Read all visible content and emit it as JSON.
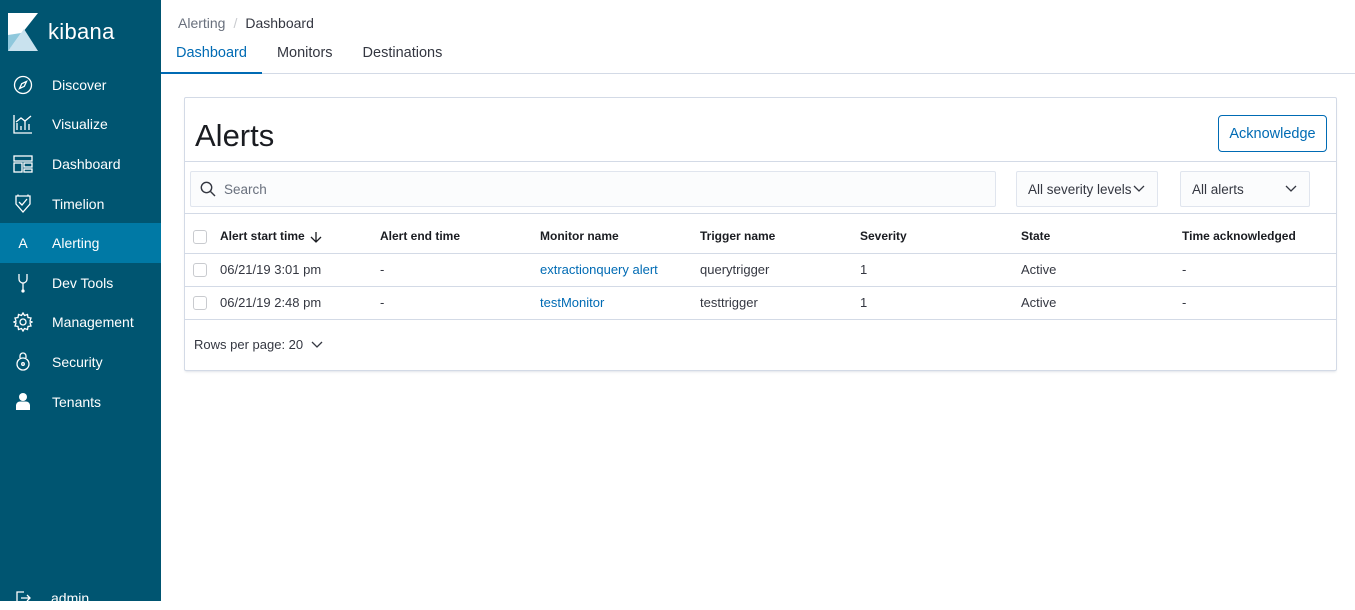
{
  "app": {
    "logo_text": "kibana"
  },
  "sidebar": {
    "items": [
      {
        "label": "Discover",
        "icon": "compass-icon"
      },
      {
        "label": "Visualize",
        "icon": "chart-icon"
      },
      {
        "label": "Dashboard",
        "icon": "dashboard-icon"
      },
      {
        "label": "Timelion",
        "icon": "timelion-icon"
      },
      {
        "label": "Alerting",
        "icon": "alerting-letter-icon",
        "active": true,
        "glyph": "A"
      },
      {
        "label": "Dev Tools",
        "icon": "wrench-icon"
      },
      {
        "label": "Management",
        "icon": "gear-icon"
      },
      {
        "label": "Security",
        "icon": "lock-icon"
      },
      {
        "label": "Tenants",
        "icon": "user-icon"
      }
    ],
    "user_label": "admin"
  },
  "breadcrumbs": {
    "parent": "Alerting",
    "separator": "/",
    "current": "Dashboard"
  },
  "tabs": [
    {
      "label": "Dashboard",
      "active": true
    },
    {
      "label": "Monitors"
    },
    {
      "label": "Destinations"
    }
  ],
  "panel": {
    "title": "Alerts",
    "acknowledge_label": "Acknowledge",
    "search_placeholder": "Search",
    "severity_select": "All severity levels",
    "alerts_select": "All alerts",
    "rows_per_page": "Rows per page: 20"
  },
  "table": {
    "columns": [
      "Alert start time",
      "Alert end time",
      "Monitor name",
      "Trigger name",
      "Severity",
      "State",
      "Time acknowledged"
    ],
    "rows": [
      {
        "start": "06/21/19 3:01 pm",
        "end": "-",
        "monitor": "extractionquery alert",
        "trigger": "querytrigger",
        "severity": "1",
        "state": "Active",
        "ack": "-"
      },
      {
        "start": "06/21/19 2:48 pm",
        "end": "-",
        "monitor": "testMonitor",
        "trigger": "testtrigger",
        "severity": "1",
        "state": "Active",
        "ack": "-"
      }
    ]
  },
  "colors": {
    "sidebar_bg": "#005571",
    "sidebar_active": "#0079a5",
    "accent": "#006bb4"
  }
}
